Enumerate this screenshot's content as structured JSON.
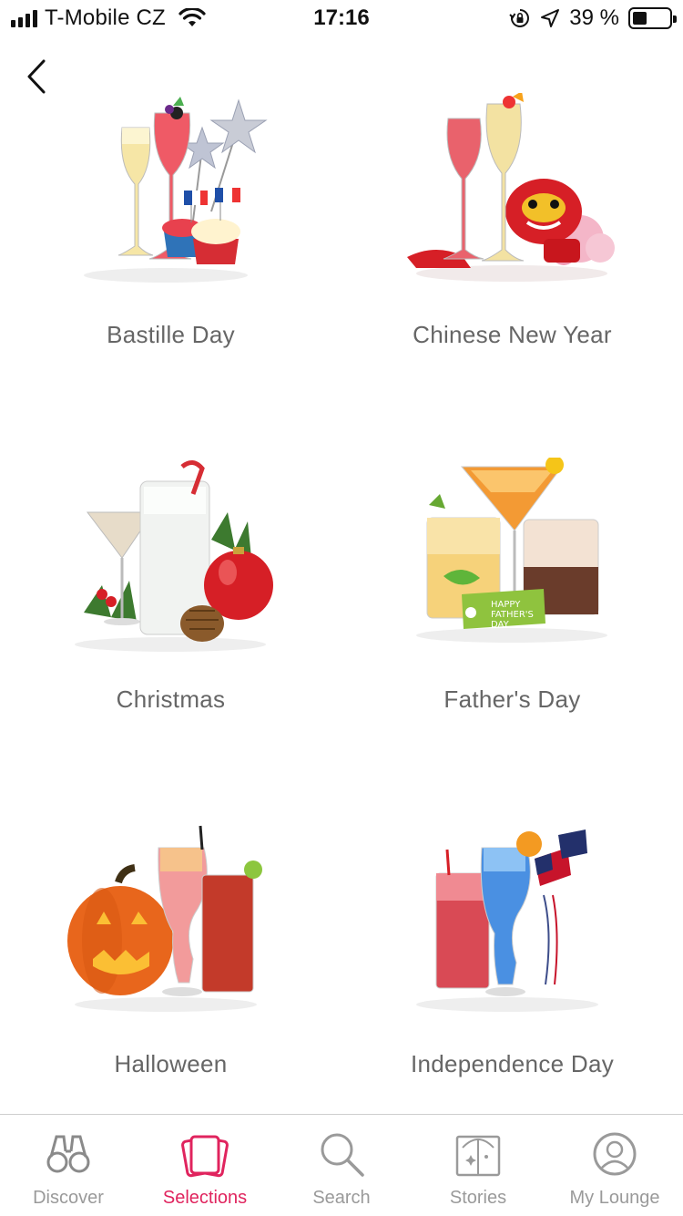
{
  "status_bar": {
    "carrier": "T-Mobile CZ",
    "time": "17:16",
    "battery_percent": "39 %",
    "battery_level": 0.39
  },
  "selections": [
    {
      "label": "Bastille Day",
      "theme": "bastille-day"
    },
    {
      "label": "Chinese New Year",
      "theme": "chinese-new-year"
    },
    {
      "label": "Christmas",
      "theme": "christmas"
    },
    {
      "label": "Father's Day",
      "theme": "fathers-day"
    },
    {
      "label": "Halloween",
      "theme": "halloween"
    },
    {
      "label": "Independence Day",
      "theme": "independence-day"
    }
  ],
  "tab_bar": {
    "tabs": [
      {
        "label": "Discover",
        "icon": "binoculars-icon",
        "active": false
      },
      {
        "label": "Selections",
        "icon": "cards-icon",
        "active": true
      },
      {
        "label": "Search",
        "icon": "search-icon",
        "active": false
      },
      {
        "label": "Stories",
        "icon": "book-icon",
        "active": false
      },
      {
        "label": "My Lounge",
        "icon": "profile-icon",
        "active": false
      }
    ]
  },
  "colors": {
    "accent": "#e0245e",
    "inactive": "#9a9a9a",
    "label_text": "#666666"
  }
}
